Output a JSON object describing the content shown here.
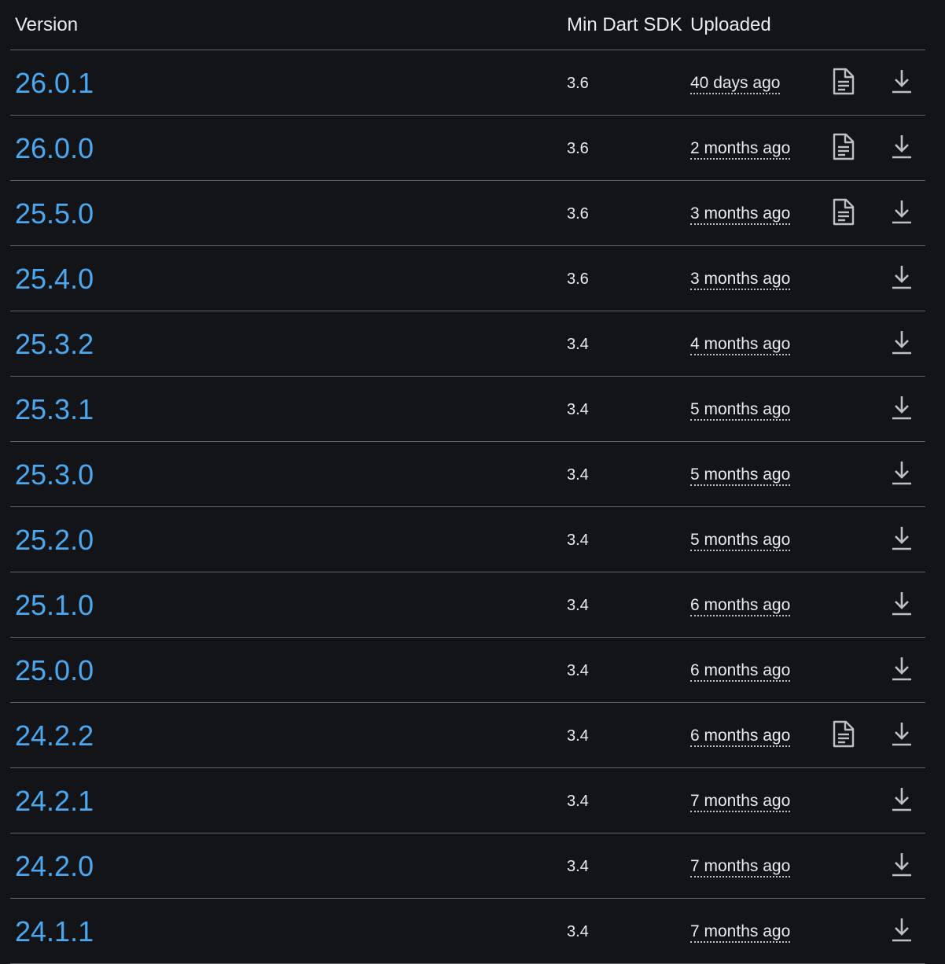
{
  "header": {
    "version_label": "Version",
    "sdk_label": "Min Dart SDK",
    "uploaded_label": "Uploaded"
  },
  "icons": {
    "changelog": "document-icon",
    "download": "download-icon"
  },
  "colors": {
    "background": "#131418",
    "link": "#4aa8f0",
    "text": "#e8eaed",
    "divider": "#5f6368"
  },
  "rows": [
    {
      "version": "26.0.1",
      "sdk": "3.6",
      "uploaded": "40 days ago",
      "has_changelog": true
    },
    {
      "version": "26.0.0",
      "sdk": "3.6",
      "uploaded": "2 months ago",
      "has_changelog": true
    },
    {
      "version": "25.5.0",
      "sdk": "3.6",
      "uploaded": "3 months ago",
      "has_changelog": true
    },
    {
      "version": "25.4.0",
      "sdk": "3.6",
      "uploaded": "3 months ago",
      "has_changelog": false
    },
    {
      "version": "25.3.2",
      "sdk": "3.4",
      "uploaded": "4 months ago",
      "has_changelog": false
    },
    {
      "version": "25.3.1",
      "sdk": "3.4",
      "uploaded": "5 months ago",
      "has_changelog": false
    },
    {
      "version": "25.3.0",
      "sdk": "3.4",
      "uploaded": "5 months ago",
      "has_changelog": false
    },
    {
      "version": "25.2.0",
      "sdk": "3.4",
      "uploaded": "5 months ago",
      "has_changelog": false
    },
    {
      "version": "25.1.0",
      "sdk": "3.4",
      "uploaded": "6 months ago",
      "has_changelog": false
    },
    {
      "version": "25.0.0",
      "sdk": "3.4",
      "uploaded": "6 months ago",
      "has_changelog": false
    },
    {
      "version": "24.2.2",
      "sdk": "3.4",
      "uploaded": "6 months ago",
      "has_changelog": true
    },
    {
      "version": "24.2.1",
      "sdk": "3.4",
      "uploaded": "7 months ago",
      "has_changelog": false
    },
    {
      "version": "24.2.0",
      "sdk": "3.4",
      "uploaded": "7 months ago",
      "has_changelog": false
    },
    {
      "version": "24.1.1",
      "sdk": "3.4",
      "uploaded": "7 months ago",
      "has_changelog": false
    }
  ]
}
